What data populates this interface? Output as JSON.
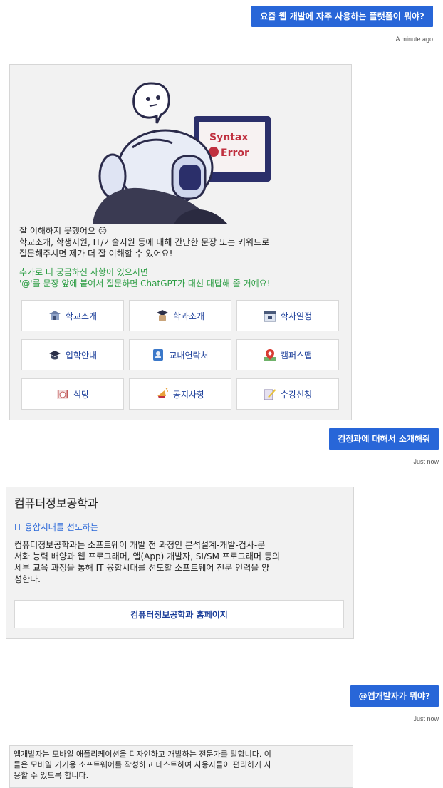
{
  "messages": {
    "q1": {
      "text": "요즘 웹 개발에 자주 사용하는 플랫폼이 뭐야?",
      "time": "A minute ago"
    },
    "bot1": {
      "illustration_text_1": "Syntax",
      "illustration_text_2": "Error",
      "line1": "잘 이해하지 못했어요 😥",
      "line2": "학교소개, 학생지원, IT/기술지원 등에 대해 간단한 문장 또는 키워드로",
      "line3": "질문해주시면 제가 더 잘 이해할 수 있어요!",
      "hint1": "추가로 더 궁금하신 사항이 있으시면",
      "hint2": "'@'를 문장 앞에 붙여서 질문하면 ChatGPT가 대신 대답해 줄 거예요!",
      "buttons": [
        {
          "label": "학교소개",
          "icon": "school-icon"
        },
        {
          "label": "학과소개",
          "icon": "graduate-icon"
        },
        {
          "label": "학사일정",
          "icon": "calendar-icon"
        },
        {
          "label": "입학안내",
          "icon": "graduation-cap-icon"
        },
        {
          "label": "교내연락처",
          "icon": "contact-book-icon"
        },
        {
          "label": "캠퍼스맵",
          "icon": "map-pin-icon"
        },
        {
          "label": "식당",
          "icon": "restaurant-icon"
        },
        {
          "label": "공지사항",
          "icon": "megaphone-icon"
        },
        {
          "label": "수강신청",
          "icon": "pencil-note-icon"
        }
      ]
    },
    "q2": {
      "text": "컴정과에 대해서 소개해줘",
      "time": "Just now"
    },
    "bot2": {
      "title": "컴퓨터정보공학과",
      "subtitle": "IT 융합시대를 선도하는",
      "body1": "컴퓨터정보공학과는 소프트웨어 개발 전 과정인 분석설계-개발-검사-문",
      "body2": "서화 능력 배양과 웹 프로그래머, 앱(App) 개발자, SI/SM 프로그래머 등의",
      "body3": "세부 교육 과정을 통해 IT 융합시대를 선도할 소프트웨어 전문 인력을 양",
      "body4": "성한다.",
      "link_label": "컴퓨터정보공학과 홈페이지"
    },
    "q3": {
      "text": "@앱개발자가 뭐야?",
      "time": "Just now"
    },
    "bot3": {
      "line1": "앱개발자는 모바일 애플리케이션을 디자인하고 개발하는 전문가를 말합니다. 이",
      "line2": "들은 모바일 기기용 소프트웨어를 작성하고 테스트하여 사용자들이 편리하게 사",
      "line3": "용할 수 있도록 합니다."
    }
  },
  "colors": {
    "user_bubble": "#2866d8",
    "link_text": "#1c3f9a",
    "hint_green": "#2e9e45",
    "subtitle_blue": "#2866d8"
  }
}
